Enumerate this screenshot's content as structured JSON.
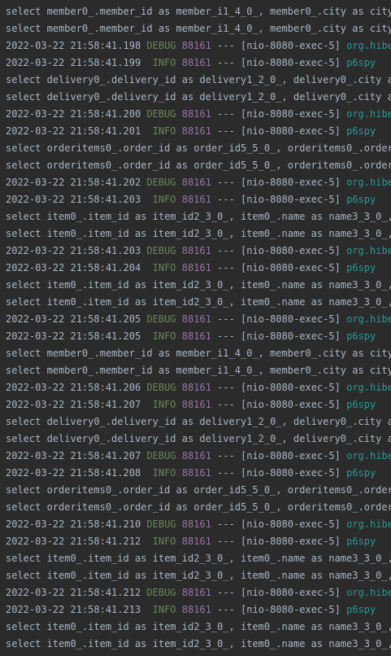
{
  "console": {
    "lines": [
      {
        "type": "sql",
        "text": "select member0_.member_id as member_i1_4_0_, member0_.city as city"
      },
      {
        "type": "sql",
        "text": "select member0_.member_id as member_i1_4_0_, member0_.city as city"
      },
      {
        "type": "log",
        "ts": "2022-03-22 21:58:41.198",
        "level": "DEBUG",
        "pid": "88161",
        "sep": "---",
        "thread": "[nio-8080-exec-5]",
        "logger": "org.hibe"
      },
      {
        "type": "log",
        "ts": "2022-03-22 21:58:41.199",
        "level": " INFO",
        "pid": "88161",
        "sep": "---",
        "thread": "[nio-8080-exec-5]",
        "logger": "p6spy"
      },
      {
        "type": "sql",
        "text": "select delivery0_.delivery_id as delivery1_2_0_, delivery0_.city a"
      },
      {
        "type": "sql",
        "text": "select delivery0_.delivery_id as delivery1_2_0_, delivery0_.city a"
      },
      {
        "type": "log",
        "ts": "2022-03-22 21:58:41.200",
        "level": "DEBUG",
        "pid": "88161",
        "sep": "---",
        "thread": "[nio-8080-exec-5]",
        "logger": "org.hibe"
      },
      {
        "type": "log",
        "ts": "2022-03-22 21:58:41.201",
        "level": " INFO",
        "pid": "88161",
        "sep": "---",
        "thread": "[nio-8080-exec-5]",
        "logger": "p6spy"
      },
      {
        "type": "sql",
        "text": "select orderitems0_.order_id as order_id5_5_0_, orderitems0_.order"
      },
      {
        "type": "sql",
        "text": "select orderitems0_.order_id as order_id5_5_0_, orderitems0_.order"
      },
      {
        "type": "log",
        "ts": "2022-03-22 21:58:41.202",
        "level": "DEBUG",
        "pid": "88161",
        "sep": "---",
        "thread": "[nio-8080-exec-5]",
        "logger": "org.hibe"
      },
      {
        "type": "log",
        "ts": "2022-03-22 21:58:41.203",
        "level": " INFO",
        "pid": "88161",
        "sep": "---",
        "thread": "[nio-8080-exec-5]",
        "logger": "p6spy"
      },
      {
        "type": "sql",
        "text": "select item0_.item_id as item_id2_3_0_, item0_.name as name3_3_0_,"
      },
      {
        "type": "sql",
        "text": "select item0_.item_id as item_id2_3_0_, item0_.name as name3_3_0_,"
      },
      {
        "type": "log",
        "ts": "2022-03-22 21:58:41.203",
        "level": "DEBUG",
        "pid": "88161",
        "sep": "---",
        "thread": "[nio-8080-exec-5]",
        "logger": "org.hibe"
      },
      {
        "type": "log",
        "ts": "2022-03-22 21:58:41.204",
        "level": " INFO",
        "pid": "88161",
        "sep": "---",
        "thread": "[nio-8080-exec-5]",
        "logger": "p6spy"
      },
      {
        "type": "sql",
        "text": "select item0_.item_id as item_id2_3_0_, item0_.name as name3_3_0_,"
      },
      {
        "type": "sql",
        "text": "select item0_.item_id as item_id2_3_0_, item0_.name as name3_3_0_,"
      },
      {
        "type": "log",
        "ts": "2022-03-22 21:58:41.205",
        "level": "DEBUG",
        "pid": "88161",
        "sep": "---",
        "thread": "[nio-8080-exec-5]",
        "logger": "org.hibe"
      },
      {
        "type": "log",
        "ts": "2022-03-22 21:58:41.205",
        "level": " INFO",
        "pid": "88161",
        "sep": "---",
        "thread": "[nio-8080-exec-5]",
        "logger": "p6spy"
      },
      {
        "type": "sql",
        "text": "select member0_.member_id as member_i1_4_0_, member0_.city as city"
      },
      {
        "type": "sql",
        "text": "select member0_.member_id as member_i1_4_0_, member0_.city as city"
      },
      {
        "type": "log",
        "ts": "2022-03-22 21:58:41.206",
        "level": "DEBUG",
        "pid": "88161",
        "sep": "---",
        "thread": "[nio-8080-exec-5]",
        "logger": "org.hibe"
      },
      {
        "type": "log",
        "ts": "2022-03-22 21:58:41.207",
        "level": " INFO",
        "pid": "88161",
        "sep": "---",
        "thread": "[nio-8080-exec-5]",
        "logger": "p6spy"
      },
      {
        "type": "sql",
        "text": "select delivery0_.delivery_id as delivery1_2_0_, delivery0_.city a"
      },
      {
        "type": "sql",
        "text": "select delivery0_.delivery_id as delivery1_2_0_, delivery0_.city a"
      },
      {
        "type": "log",
        "ts": "2022-03-22 21:58:41.207",
        "level": "DEBUG",
        "pid": "88161",
        "sep": "---",
        "thread": "[nio-8080-exec-5]",
        "logger": "org.hibe"
      },
      {
        "type": "log",
        "ts": "2022-03-22 21:58:41.208",
        "level": " INFO",
        "pid": "88161",
        "sep": "---",
        "thread": "[nio-8080-exec-5]",
        "logger": "p6spy"
      },
      {
        "type": "sql",
        "text": "select orderitems0_.order_id as order_id5_5_0_, orderitems0_.order"
      },
      {
        "type": "sql",
        "text": "select orderitems0_.order_id as order_id5_5_0_, orderitems0_.order"
      },
      {
        "type": "log",
        "ts": "2022-03-22 21:58:41.210",
        "level": "DEBUG",
        "pid": "88161",
        "sep": "---",
        "thread": "[nio-8080-exec-5]",
        "logger": "org.hibe"
      },
      {
        "type": "log",
        "ts": "2022-03-22 21:58:41.212",
        "level": " INFO",
        "pid": "88161",
        "sep": "---",
        "thread": "[nio-8080-exec-5]",
        "logger": "p6spy"
      },
      {
        "type": "sql",
        "text": "select item0_.item_id as item_id2_3_0_, item0_.name as name3_3_0_,"
      },
      {
        "type": "sql",
        "text": "select item0_.item_id as item_id2_3_0_, item0_.name as name3_3_0_,"
      },
      {
        "type": "log",
        "ts": "2022-03-22 21:58:41.212",
        "level": "DEBUG",
        "pid": "88161",
        "sep": "---",
        "thread": "[nio-8080-exec-5]",
        "logger": "org.hibe"
      },
      {
        "type": "log",
        "ts": "2022-03-22 21:58:41.213",
        "level": " INFO",
        "pid": "88161",
        "sep": "---",
        "thread": "[nio-8080-exec-5]",
        "logger": "p6spy"
      },
      {
        "type": "sql",
        "text": "select item0_.item_id as item_id2_3_0_, item0_.name as name3_3_0_,"
      },
      {
        "type": "sql",
        "text": "select item0_.item_id as item_id2_3_0_, item0_.name as name3_3_0_,"
      }
    ]
  },
  "colors": {
    "background": "#2b2b2b",
    "text": "#a9b7c6",
    "level": "#6a8759",
    "pid": "#9876aa",
    "logger": "#299999"
  }
}
